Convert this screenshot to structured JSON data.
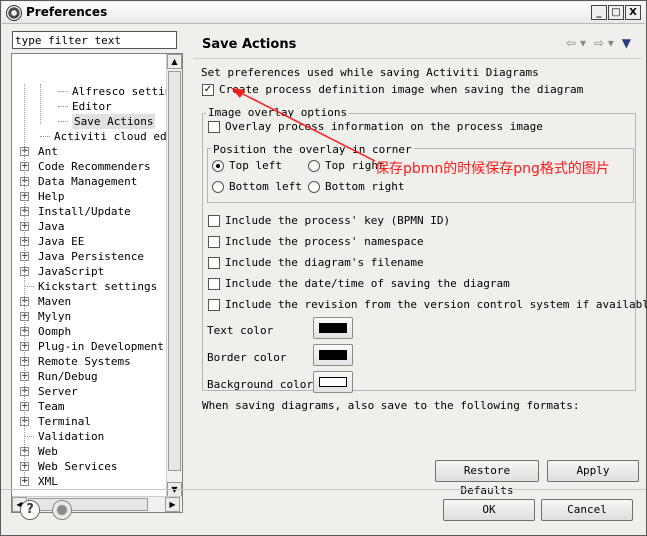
{
  "window": {
    "title": "Preferences",
    "minimize": "_",
    "maximize": "□",
    "close": "X"
  },
  "filter": {
    "text": "type filter text"
  },
  "tree": {
    "items": [
      {
        "label": "Alfresco settings",
        "expandable": false,
        "indent": 2
      },
      {
        "label": "Editor",
        "expandable": false,
        "indent": 2
      },
      {
        "label": "Save Actions",
        "expandable": false,
        "indent": 2,
        "selected": true
      },
      {
        "label": "Activiti cloud editor",
        "expandable": false,
        "indent": 1
      },
      {
        "label": "Ant",
        "expandable": true,
        "indent": 0
      },
      {
        "label": "Code Recommenders",
        "expandable": true,
        "indent": 0
      },
      {
        "label": "Data Management",
        "expandable": true,
        "indent": 0
      },
      {
        "label": "Help",
        "expandable": true,
        "indent": 0
      },
      {
        "label": "Install/Update",
        "expandable": true,
        "indent": 0
      },
      {
        "label": "Java",
        "expandable": true,
        "indent": 0
      },
      {
        "label": "Java EE",
        "expandable": true,
        "indent": 0
      },
      {
        "label": "Java Persistence",
        "expandable": true,
        "indent": 0
      },
      {
        "label": "JavaScript",
        "expandable": true,
        "indent": 0
      },
      {
        "label": "Kickstart settings",
        "expandable": false,
        "indent": 0
      },
      {
        "label": "Maven",
        "expandable": true,
        "indent": 0
      },
      {
        "label": "Mylyn",
        "expandable": true,
        "indent": 0
      },
      {
        "label": "Oomph",
        "expandable": true,
        "indent": 0
      },
      {
        "label": "Plug-in Development",
        "expandable": true,
        "indent": 0
      },
      {
        "label": "Remote Systems",
        "expandable": true,
        "indent": 0
      },
      {
        "label": "Run/Debug",
        "expandable": true,
        "indent": 0
      },
      {
        "label": "Server",
        "expandable": true,
        "indent": 0
      },
      {
        "label": "Team",
        "expandable": true,
        "indent": 0
      },
      {
        "label": "Terminal",
        "expandable": true,
        "indent": 0
      },
      {
        "label": "Validation",
        "expandable": false,
        "indent": 0
      },
      {
        "label": "Web",
        "expandable": true,
        "indent": 0
      },
      {
        "label": "Web Services",
        "expandable": true,
        "indent": 0
      },
      {
        "label": "XML",
        "expandable": true,
        "indent": 0
      }
    ]
  },
  "page": {
    "title": "Save Actions",
    "description": "Set preferences used while saving Activiti Diagrams",
    "create_image": {
      "label": "Create process definition image when saving the diagram",
      "checked": true
    },
    "overlay_group": {
      "title": "Image overlay options",
      "overlay_info": {
        "label": "Overlay process information on the process image",
        "checked": false
      },
      "position_group": {
        "title": "Position the overlay in corner",
        "top_left": {
          "label": "Top left",
          "selected": true
        },
        "top_right": {
          "label": "Top right",
          "selected": false
        },
        "bottom_left": {
          "label": "Bottom left",
          "selected": false
        },
        "bottom_right": {
          "label": "Bottom right",
          "selected": false
        }
      },
      "include_key": {
        "label": "Include the process' key (BPMN ID)",
        "checked": false
      },
      "include_namespace": {
        "label": "Include the process' namespace",
        "checked": false
      },
      "include_filename": {
        "label": "Include the diagram's filename",
        "checked": false
      },
      "include_datetime": {
        "label": "Include the date/time of saving the diagram",
        "checked": false
      },
      "include_revision": {
        "label": "Include the revision from the version control system if available",
        "checked": false
      },
      "text_color": {
        "label": "Text color",
        "value": "#000000"
      },
      "border_color": {
        "label": "Border color",
        "value": "#000000"
      },
      "background_color": {
        "label": "Background color",
        "value": "#ffffff"
      }
    },
    "formats_label": "When saving diagrams, also save to the following formats:",
    "annotation": "保存pbmn的时候保存png格式的图片",
    "annotation_color": "#ff1a1a"
  },
  "buttons": {
    "restore_defaults": "Restore Defaults",
    "apply": "Apply",
    "ok": "OK",
    "cancel": "Cancel"
  },
  "icons": {
    "help": "?",
    "nav_back": "⇦",
    "nav_forward": "⇨",
    "dropdown": "▾",
    "view_menu": "▼"
  }
}
